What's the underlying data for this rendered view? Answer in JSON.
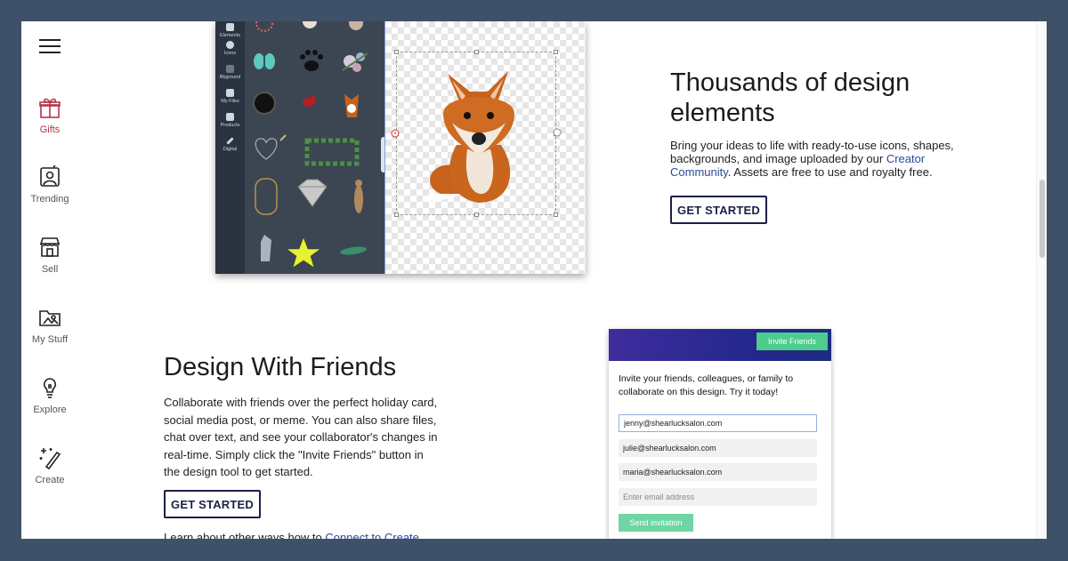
{
  "sidebar": {
    "items": [
      {
        "label": "Gifts"
      },
      {
        "label": "Trending"
      },
      {
        "label": "Sell"
      },
      {
        "label": "My Stuff"
      },
      {
        "label": "Explore"
      },
      {
        "label": "Create"
      }
    ]
  },
  "editor": {
    "rail": [
      {
        "label": "Elements"
      },
      {
        "label": "Icons"
      },
      {
        "label": "Bkground"
      },
      {
        "label": "My Files"
      },
      {
        "label": "Products"
      },
      {
        "label": "Digital"
      }
    ]
  },
  "section1": {
    "title": "Thousands of design elements",
    "body_prefix": "Bring your ideas to life with ready-to-use icons, shapes, backgrounds, and image uploaded by our ",
    "body_link": "Creator Community",
    "body_suffix": ". Assets are free to use and royalty free.",
    "cta": "GET STARTED"
  },
  "section2": {
    "title": "Design With Friends",
    "body": "Collaborate with friends over the perfect holiday card, social media post, or meme. You can also share files, chat over text, and see your collaborator's changes in real-time. Simply click the \"Invite Friends\" button in the design tool to get started.",
    "cta": "GET STARTED",
    "learn_prefix": "Learn about other ways how to ",
    "learn_link": "Connect to Create"
  },
  "invite": {
    "button": "Invite Friends",
    "text": "Invite your friends, colleagues, or family to collaborate on this design. Try it today!",
    "emails": [
      "jenny@shearlucksalon.com",
      "julie@shearlucksalon.com",
      "maria@shearlucksalon.com"
    ],
    "placeholder": "Enter email address",
    "send": "Send invitation"
  },
  "colors": {
    "accent_active": "#b7334a",
    "button_border": "#1b2049",
    "link": "#2b4a99",
    "invite_green": "#4ccc8d",
    "background": "#3f5069"
  }
}
